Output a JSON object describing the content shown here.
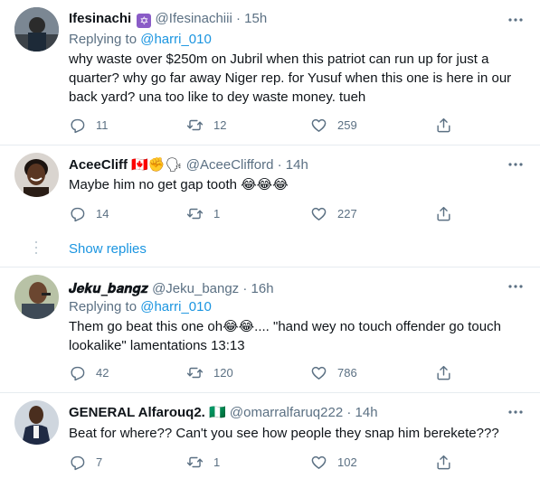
{
  "tweets": [
    {
      "name": "Ifesinachi",
      "badge": "✡",
      "handle": "@Ifesinachiii",
      "time": "15h",
      "replying_label": "Replying to",
      "replying_to": "@harri_010",
      "text": "why waste over $250m on Jubril when this patriot can run up for just a quarter? why go far away Niger rep. for Yusuf when this one is here in our back yard? una too like to dey waste money. tueh",
      "replies": "11",
      "retweets": "12",
      "likes": "259"
    },
    {
      "name": "AceeCliff",
      "name_emojis": "🇨🇦✊🗣",
      "handle": "@AceeClifford",
      "time": "14h",
      "text": "Maybe him no get gap tooth",
      "text_emojis": "😂😂😂",
      "replies": "14",
      "retweets": "1",
      "likes": "227"
    },
    {
      "name": "𝑱𝒆𝒌𝒖_𝒃𝒂𝒏𝒈𝒛",
      "handle": "@Jeku_bangz",
      "time": "16h",
      "replying_label": "Replying to",
      "replying_to": "@harri_010",
      "text": "Them go beat this one oh😂😂.... \"hand wey no touch offender go touch lookalike\" lamentations 13:13",
      "replies": "42",
      "retweets": "120",
      "likes": "786"
    },
    {
      "name": "GENERAL Alfarouq2.",
      "name_emojis": "🇳🇬",
      "handle": "@omarralfaruq222",
      "time": "14h",
      "text": "Beat for where?? Can't you see how people they snap him berekete???",
      "replies": "7",
      "retweets": "1",
      "likes": "102"
    }
  ],
  "show_replies": "Show replies",
  "separator_dot": "·",
  "colors": {
    "link": "#1b95e0",
    "muted": "#5b7083",
    "text": "#0f1419",
    "divider": "#e6ecf0"
  }
}
